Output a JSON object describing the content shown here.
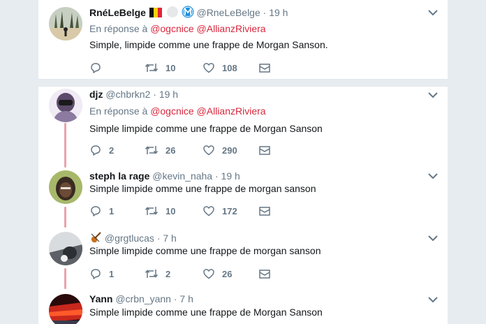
{
  "tweets": [
    {
      "name": "RnéLeBelge",
      "handle": "@RneLeBelge",
      "time": "19 h",
      "reply_prefix": "En réponse à",
      "reply_mentions": [
        "@ogcnice",
        "@AllianzRiviera"
      ],
      "text": "Simple, limpide comme une frappe de Morgan Sanson.",
      "replies": "",
      "retweets": "10",
      "likes": "108",
      "icons": [
        "belgium-flag-icon",
        "circle-badge-icon",
        "metro-badge-icon"
      ]
    },
    {
      "name": "djz",
      "handle": "@chbrkn2",
      "time": "19 h",
      "reply_prefix": "En réponse à",
      "reply_mentions": [
        "@ogcnice",
        "@AllianzRiviera"
      ],
      "text": "Simple limpide comme une frappe de Morgan Sanson",
      "replies": "2",
      "retweets": "26",
      "likes": "290"
    },
    {
      "name": "steph la rage",
      "handle": "@kevin_naha",
      "time": "19 h",
      "text": "Simple limpide omme une frappe de morgan sanson",
      "replies": "1",
      "retweets": "10",
      "likes": "172"
    },
    {
      "name": "",
      "name_icon": "violin-icon",
      "handle": "@grgtlucas",
      "time": "7 h",
      "text": "Simple limpide comme une frappe de morgan sanson",
      "replies": "1",
      "retweets": "2",
      "likes": "26"
    },
    {
      "name": "Yann",
      "handle": "@crbn_yann",
      "time": "7 h",
      "text": "Simple limpide comme une frappe de Morgan Sanson"
    }
  ],
  "separator": "·",
  "colors": {
    "mention": "#d9273c",
    "thread_line": "#e8a3aa",
    "muted": "#657786",
    "background": "#e6ecf0"
  }
}
